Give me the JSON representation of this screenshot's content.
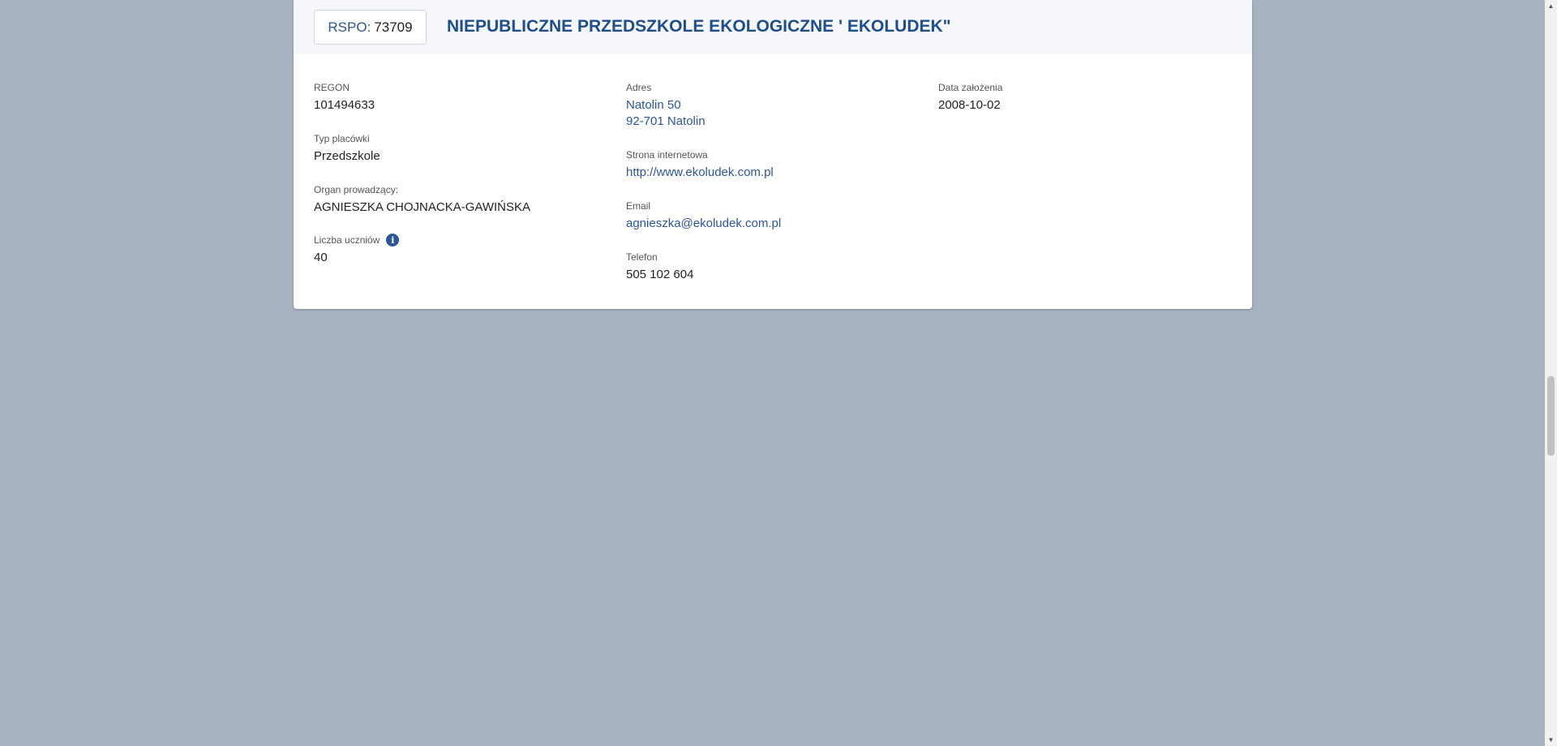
{
  "header": {
    "rspo_label": "RSPO:",
    "rspo_value": "73709",
    "school_name": "NIEPUBLICZNE PRZEDSZKOLE EKOLOGICZNE ' EKOLUDEK\""
  },
  "fields": {
    "regon": {
      "label": "REGON",
      "value": "101494633"
    },
    "typ": {
      "label": "Typ placówki",
      "value": "Przedszkole"
    },
    "organ": {
      "label": "Organ prowadzący:",
      "value": "AGNIESZKA CHOJNACKA-GAWIŃSKA"
    },
    "liczba": {
      "label": "Liczba uczniów",
      "value": "40",
      "info_icon": "i"
    },
    "adres": {
      "label": "Adres",
      "line1": "Natolin 50",
      "line2": "92-701 Natolin"
    },
    "strona": {
      "label": "Strona internetowa",
      "value": "http://www.ekoludek.com.pl"
    },
    "email": {
      "label": "Email",
      "value": "agnieszka@ekoludek.com.pl"
    },
    "telefon": {
      "label": "Telefon",
      "value": "505 102 604"
    },
    "data_zalozenia": {
      "label": "Data założenia",
      "value": "2008-10-02"
    }
  },
  "scrollbar": {
    "up_arrow": "▲",
    "down_arrow": "▼"
  },
  "colors": {
    "page_background": "#a8b3c2",
    "accent": "#2b5797",
    "title": "#1f4e8c",
    "header_background": "#f5f7fb"
  }
}
